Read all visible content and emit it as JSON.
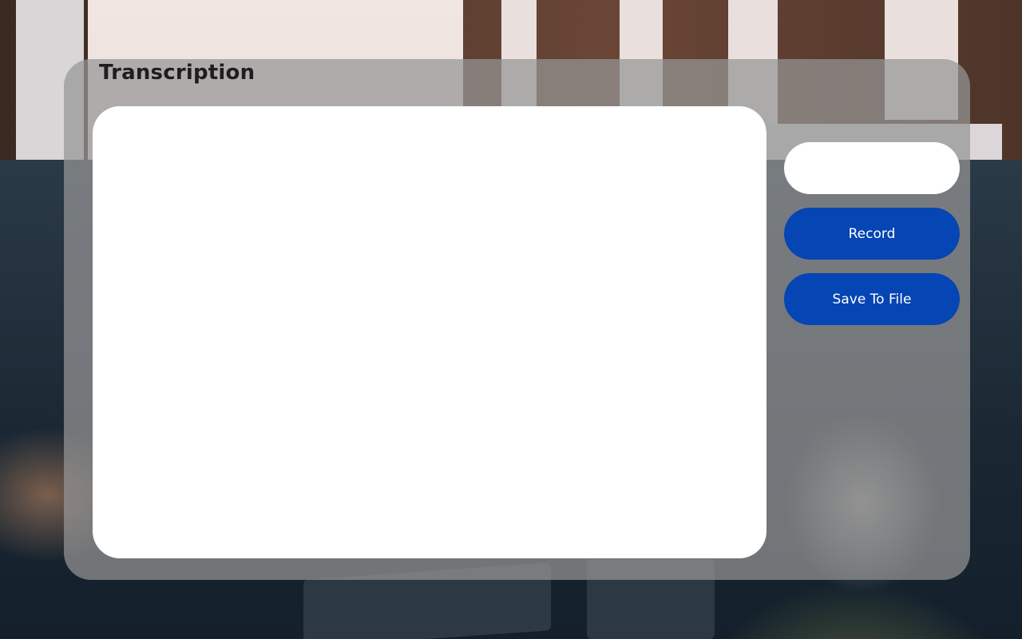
{
  "app": {
    "title": "Transcription"
  },
  "transcript": {
    "value": ""
  },
  "file_name_input": {
    "value": "",
    "placeholder": ""
  },
  "actions": {
    "record_label": "Record",
    "save_label": "Save To File"
  },
  "colors": {
    "accent": "#0645b4",
    "panel": "#969696",
    "surface": "#ffffff",
    "title_text": "#1e1e1e"
  }
}
